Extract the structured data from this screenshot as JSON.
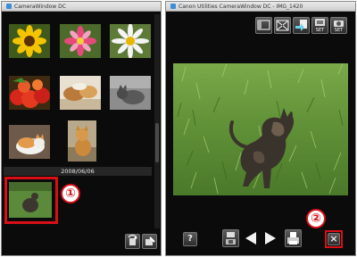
{
  "left_window": {
    "title": "CameraWindow DC",
    "date_separator": "2008/06/06",
    "thumbnails": [
      {
        "icon": "sunflower-photo"
      },
      {
        "icon": "pink-flower-photo"
      },
      {
        "icon": "white-daisy-photo"
      },
      {
        "icon": "strawberries-photo"
      },
      {
        "icon": "dessert-photo"
      },
      {
        "icon": "gray-cat-photo"
      },
      {
        "icon": "kitten-photo"
      },
      {
        "icon": "dog-photo"
      },
      {
        "icon": "cat-on-grass-photo"
      }
    ],
    "bottom_buttons": [
      {
        "icon": "rotate-icon"
      },
      {
        "icon": "edit-icon"
      }
    ]
  },
  "right_window": {
    "title": "Canon Utilities CameraWindow DC - IMG_1420",
    "toolbar": [
      {
        "icon": "single-view-icon",
        "label": ""
      },
      {
        "icon": "full-screen-icon",
        "label": ""
      },
      {
        "icon": "import-icon",
        "label": ""
      },
      {
        "icon": "set-wallpaper-icon",
        "label": "SET"
      },
      {
        "icon": "set-camera-icon",
        "label": "SET"
      }
    ],
    "bottom_bar": {
      "help_label": "?",
      "close_label": "×"
    }
  },
  "annotations": {
    "badge_1": "①",
    "badge_2": "②",
    "highlight_color": "#d80f17"
  }
}
